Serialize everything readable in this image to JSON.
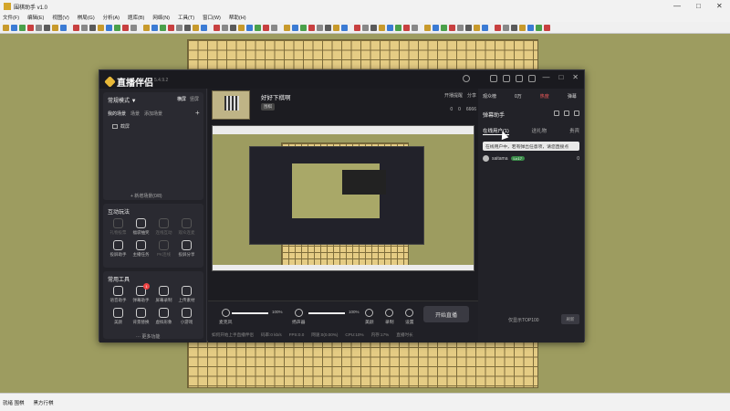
{
  "host": {
    "title": "围棋助手 v1.0",
    "menu": [
      "文件(F)",
      "编辑(E)",
      "视图(V)",
      "棋局(G)",
      "分析(A)",
      "题库(B)",
      "网络(N)",
      "工具(T)",
      "窗口(W)",
      "帮助(H)"
    ],
    "status": [
      "就绪 围棋",
      "黑方行棋"
    ],
    "background": "#9d9c60",
    "board_color": "#e5cc84"
  },
  "streaming": {
    "app_name": "直播伴侣",
    "version": "5.4.9.2",
    "window_controls": [
      "—",
      "□",
      "✕"
    ],
    "scene": {
      "mode": "常规模式 ▼",
      "switch": "横屏",
      "switch2": "竖屏",
      "tabs": [
        "我的场景",
        "场景",
        "添加场景"
      ],
      "add_icon": "+",
      "item": "截屏",
      "add_scene": "+ 新增场景(0/8)"
    },
    "interact": {
      "title": "互动玩法",
      "items": [
        {
          "label": "礼物投票",
          "dim": true
        },
        {
          "label": "福袋抽奖",
          "dim": false
        },
        {
          "label": "连线互动",
          "dim": true
        },
        {
          "label": "观众连麦",
          "dim": true
        },
        {
          "label": "投屏助手",
          "dim": false
        },
        {
          "label": "主播任务",
          "dim": false
        },
        {
          "label": "PK连线",
          "dim": true
        },
        {
          "label": "投屏分享",
          "dim": false
        }
      ]
    },
    "tools": {
      "title": "常用工具",
      "items": [
        {
          "label": "语音助手",
          "badge": ""
        },
        {
          "label": "弹幕助手",
          "badge": "1"
        },
        {
          "label": "屏幕录制",
          "badge": ""
        },
        {
          "label": "上传素材",
          "badge": ""
        },
        {
          "label": "美颜",
          "badge": ""
        },
        {
          "label": "背景替换",
          "badge": ""
        },
        {
          "label": "虚拟形象",
          "badge": ""
        },
        {
          "label": "小游戏",
          "badge": ""
        }
      ],
      "more": "··· 更多功能"
    },
    "room": {
      "title": "好好下棋啊",
      "tag": "围棋",
      "right_top": [
        "开播提醒",
        "分享"
      ],
      "right_bottom": [
        "0",
        "0",
        "6666"
      ]
    },
    "controls": {
      "mic_label": "麦克风",
      "mic_val": "100%",
      "speaker_label": "扬声器",
      "speaker_val": "100%",
      "items": [
        "美颜",
        "录制",
        "设置"
      ],
      "start": "开始直播",
      "stats": [
        "如何开始上手直播伴侣",
        "码率:0 kb/s",
        "FPS:0.0",
        "网速:0(0.00%)",
        "CPU:10%",
        "内存:17%",
        "直播时长"
      ]
    },
    "right": {
      "top": [
        "观众榜",
        "0万",
        "热度",
        "弹幕"
      ],
      "helper_title": "弹幕助手",
      "tabs": [
        "在线用户(1)",
        "送礼物",
        "贵宾"
      ],
      "notice": "在线用户中，若有弹出任意项，请您直接点",
      "user": {
        "name": "saitama",
        "level": "Lv.17",
        "count": "0"
      },
      "bottom": "仅显示TOP100",
      "bottom_btn": "刷新"
    }
  }
}
